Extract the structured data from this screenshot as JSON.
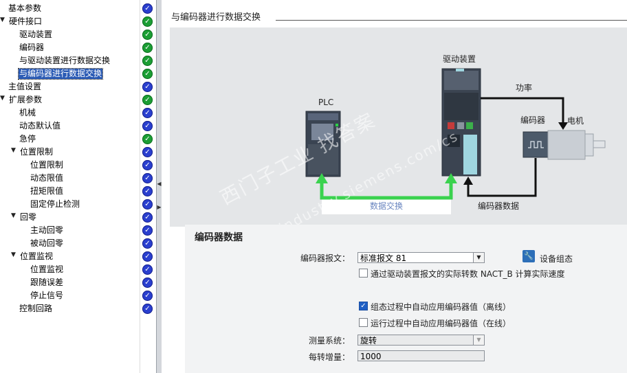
{
  "tree": {
    "items": [
      {
        "label": "基本参数",
        "expander": "",
        "status": "blue"
      },
      {
        "label": "硬件接口",
        "expander": "▼",
        "status": "green"
      },
      {
        "label": "驱动装置",
        "expander": "",
        "status": "green"
      },
      {
        "label": "编码器",
        "expander": "",
        "status": "green"
      },
      {
        "label": "与驱动装置进行数据交换",
        "expander": "",
        "status": "green"
      },
      {
        "label": "与编码器进行数据交换",
        "expander": "",
        "status": "green",
        "selected": true
      },
      {
        "label": "主值设置",
        "expander": "",
        "status": "blue"
      },
      {
        "label": "扩展参数",
        "expander": "▼",
        "status": "green"
      },
      {
        "label": "机械",
        "expander": "",
        "status": "blue"
      },
      {
        "label": "动态默认值",
        "expander": "",
        "status": "blue"
      },
      {
        "label": "急停",
        "expander": "",
        "status": "green"
      },
      {
        "label": "位置限制",
        "expander": "▼",
        "status": "blue"
      },
      {
        "label": "位置限制",
        "expander": "",
        "status": "blue"
      },
      {
        "label": "动态限值",
        "expander": "",
        "status": "blue"
      },
      {
        "label": "扭矩限值",
        "expander": "",
        "status": "blue"
      },
      {
        "label": "固定停止检测",
        "expander": "",
        "status": "blue"
      },
      {
        "label": "回零",
        "expander": "▼",
        "status": "blue"
      },
      {
        "label": "主动回零",
        "expander": "",
        "status": "blue"
      },
      {
        "label": "被动回零",
        "expander": "",
        "status": "blue"
      },
      {
        "label": "位置监视",
        "expander": "▼",
        "status": "blue"
      },
      {
        "label": "位置监视",
        "expander": "",
        "status": "blue"
      },
      {
        "label": "跟随误差",
        "expander": "",
        "status": "blue"
      },
      {
        "label": "停止信号",
        "expander": "",
        "status": "blue"
      },
      {
        "label": "控制回路",
        "expander": "",
        "status": "blue"
      }
    ]
  },
  "main": {
    "section_title": "与编码器进行数据交换",
    "diagram": {
      "plc_label": "PLC",
      "drive_label": "驱动装置",
      "power_label": "功率",
      "encoder_label": "编码器",
      "motor_label": "电机",
      "data_exchange_label": "数据交换",
      "encoder_data_label": "编码器数据"
    },
    "form": {
      "heading": "编码器数据",
      "telegram_label": "编码器报文：",
      "telegram_value": "标准报文 81",
      "device_config_label": "设备组态",
      "nact_label": "通过驱动装置报文的实际转数 NACT_B 计算实际速度",
      "nact_checked": false,
      "auto_offline_label": "组态过程中自动应用编码器值（离线）",
      "auto_offline_checked": true,
      "auto_online_label": "运行过程中自动应用编码器值（在线）",
      "auto_online_checked": false,
      "measure_system_label": "测量系统：",
      "measure_system_value": "旋转",
      "increments_label": "每转增量：",
      "increments_value": "1000"
    },
    "watermark": {
      "line1": "西门子工业 找答案",
      "line2": "support.industry.siemens.com/cs"
    }
  }
}
